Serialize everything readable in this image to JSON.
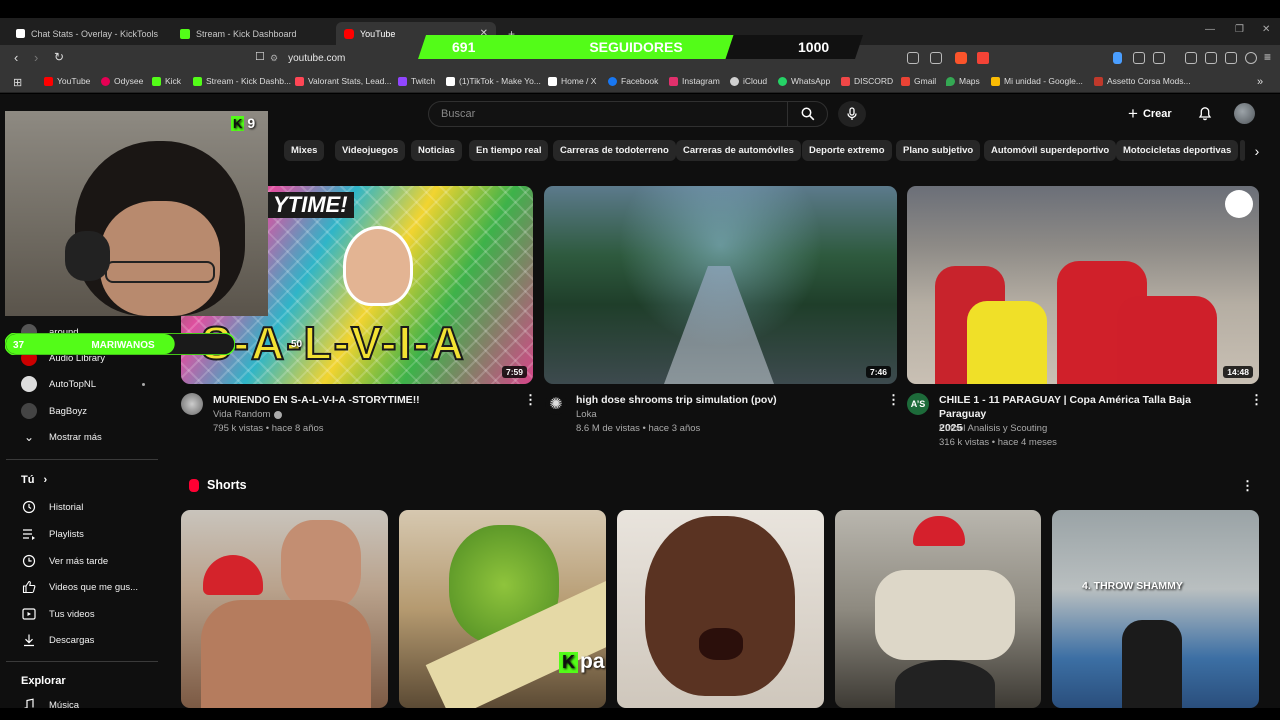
{
  "browser": {
    "tabs": [
      {
        "title": "Chat Stats - Overlay - KickTools"
      },
      {
        "title": "Stream - Kick Dashboard"
      },
      {
        "title": "YouTube"
      }
    ],
    "new_tab": "+",
    "url": "youtube.com"
  },
  "bookmarks": [
    {
      "label": "YouTube",
      "color": "#ff0000"
    },
    {
      "label": "Odysee",
      "color": "#e50054"
    },
    {
      "label": "Kick",
      "color": "#53fc18"
    },
    {
      "label": "Stream - Kick Dashb...",
      "color": "#53fc18"
    },
    {
      "label": "Valorant Stats, Lead...",
      "color": "#ff4655"
    },
    {
      "label": "Twitch",
      "color": "#9146ff"
    },
    {
      "label": "(1)TikTok - Make Yo...",
      "color": "#ffffff"
    },
    {
      "label": "Home / X",
      "color": "#ffffff"
    },
    {
      "label": "Facebook",
      "color": "#1877f2"
    },
    {
      "label": "Instagram",
      "color": "#e1306c"
    },
    {
      "label": "iCloud",
      "color": "#d0d0d0"
    },
    {
      "label": "WhatsApp",
      "color": "#25d366"
    },
    {
      "label": "DISCORD",
      "color": "#f04747"
    },
    {
      "label": "Gmail",
      "color": "#ea4335"
    },
    {
      "label": "Maps",
      "color": "#34a853"
    },
    {
      "label": "Mi unidad - Google...",
      "color": "#fbbc04"
    },
    {
      "label": "Assetto Corsa Mods...",
      "color": "#c0392b"
    }
  ],
  "overlay": {
    "followers_current": "691",
    "followers_label": "SEGUIDORES",
    "followers_goal": "1000",
    "followers_progress": 0.691,
    "kick_badge_count": "9",
    "goal_current": "37",
    "goal_label": "MARIWANOS",
    "goal_target": "50",
    "goal_progress": 0.74,
    "shorts_watermark": "palideuS"
  },
  "youtube": {
    "search_placeholder": "Buscar",
    "create_label": "Crear",
    "chips": [
      "Mixes",
      "Videojuegos",
      "Noticias",
      "En tiempo real",
      "Carreras de todoterreno",
      "Carreras de automóviles",
      "Deporte extremo",
      "Plano subjetivo",
      "Automóvil superdeportivo",
      "Motocicletas deportivas"
    ],
    "sidebar": {
      "subscriptions": [
        "around",
        "Audio Library",
        "AutoTopNL",
        "BagBoyz"
      ],
      "show_more": "Mostrar más",
      "you_header": "Tú",
      "you_items": [
        "Historial",
        "Playlists",
        "Ver más tarde",
        "Videos que me gus...",
        "Tus videos",
        "Descargas"
      ],
      "explore_header": "Explorar",
      "explore_items": [
        "Música"
      ]
    },
    "videos": [
      {
        "title": "MURIENDO EN S-A-L-V-I-A -STORYTIME!!",
        "channel": "Vida Random",
        "verified": true,
        "meta": "795 k vistas • hace 8 años",
        "duration": "7:59",
        "thumb_text": "S-A-L-V-I-A",
        "thumb_banner": "YTIME!"
      },
      {
        "title": "high dose shrooms trip simulation (pov)",
        "channel": "Loka",
        "verified": false,
        "meta": "8.6 M de vistas • hace 3 años",
        "duration": "7:46"
      },
      {
        "title_line1": "CHILE 1 - 11 PARAGUAY | Copa América Talla Baja Paraguay",
        "title_line2": "2025",
        "channel": "Futbol Analisis y Scouting",
        "verified": false,
        "meta": "316 k vistas • hace 4 meses",
        "duration": "14:48",
        "avatar_text": "A’S"
      }
    ],
    "shorts_header": "Shorts",
    "shorts": [
      {
        "overlay_text": ""
      },
      {
        "overlay_text": ""
      },
      {
        "overlay_text": ""
      },
      {
        "overlay_text": ""
      },
      {
        "overlay_text": "4. THROW SHAMMY"
      }
    ]
  }
}
